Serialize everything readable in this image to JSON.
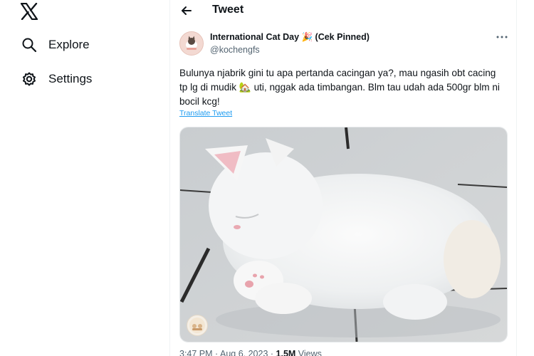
{
  "sidebar": {
    "items": [
      {
        "label": "Explore",
        "icon": "search-icon"
      },
      {
        "label": "Settings",
        "icon": "gear-icon"
      }
    ]
  },
  "header": {
    "title": "Tweet"
  },
  "tweet": {
    "display_name": "International Cat Day 🎉 (Cek Pinned)",
    "handle": "@kochengfs",
    "text": "Bulunya njabrik gini tu apa pertanda cacingan ya?, mau ngasih obt cacing tp lg di mudik 🏡 uti, nggak ada timbangan. Blm tau udah ada 500gr blm ni bocil kcg!",
    "translate_label": "Translate Tweet",
    "time": "3:47 PM",
    "date": "Aug 6, 2023",
    "views_count": "1.5M",
    "views_label": "Views"
  },
  "colors": {
    "accent": "#1d9bf0",
    "text": "#0f1419",
    "muted": "#536471"
  }
}
